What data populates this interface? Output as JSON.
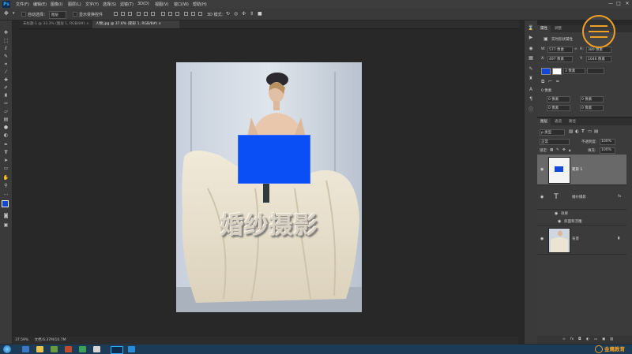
{
  "menu": {
    "logo": "Ps",
    "items": [
      "文件(F)",
      "编辑(E)",
      "图像(I)",
      "图层(L)",
      "文字(Y)",
      "选择(S)",
      "滤镜(T)",
      "3D(D)",
      "视图(V)",
      "窗口(W)",
      "帮助(H)"
    ],
    "window_controls": [
      "—",
      "□",
      "✕"
    ]
  },
  "options": {
    "auto_select_label": "自动选择：",
    "auto_select_value": "图层",
    "transform_label": "显示变换控件",
    "mode_label": "3D 模式："
  },
  "tabs": [
    {
      "label": "未标题-1 @ 33.3% (图层 1, RGB/8#) ×",
      "active": false
    },
    {
      "label": "人物.jpg @ 37.6% (矩形 1, RGB/8#) ×",
      "active": true
    }
  ],
  "canvas": {
    "overlay_text": "婚纱摄影",
    "rect_color": "#0a4ff5"
  },
  "status": {
    "zoom": "37.59%",
    "doc_info": "文档:6.37M/10.7M"
  },
  "properties": {
    "tabs": [
      "属性",
      "调整"
    ],
    "title": "实时形状属性",
    "w_label": "W:",
    "w_value": "577 像素",
    "h_label": "H:",
    "h_value": "380 像素",
    "x_label": "X:",
    "x_value": "497 像素",
    "y_label": "Y:",
    "y_value": "1046 像素",
    "stroke_value": "3 像素",
    "corner_label": "0 像素",
    "corner_values": [
      "0 像素",
      "0 像素",
      "0 像素",
      "0 像素"
    ],
    "fill_color": "#1446d8"
  },
  "layers": {
    "tabs": [
      "图层",
      "通道",
      "路径"
    ],
    "kind_label": "ρ 类型",
    "blend_mode": "正常",
    "opacity_label": "不透明度:",
    "opacity_value": "100%",
    "lock_label": "锁定:",
    "fill_label": "填充:",
    "fill_value": "100%",
    "items": [
      {
        "name": "矩形 1",
        "type": "shape"
      },
      {
        "name": "婚纱摄影",
        "type": "text"
      },
      {
        "name": "效果",
        "type": "effect"
      },
      {
        "name": "斜面和浮雕",
        "type": "effect"
      },
      {
        "name": "背景",
        "type": "image"
      }
    ]
  },
  "taskbar": {
    "time": "",
    "watermark_text": "金鹰教育"
  }
}
